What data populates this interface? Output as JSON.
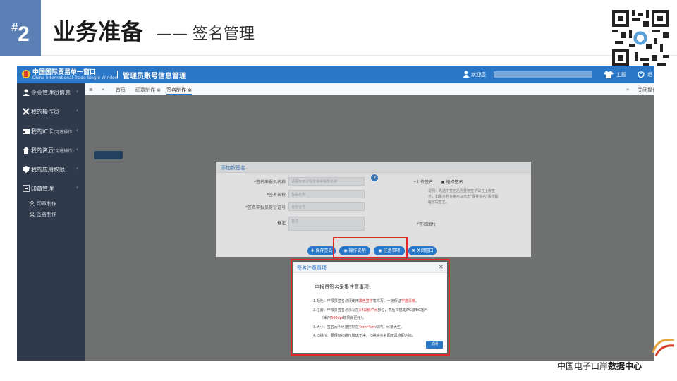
{
  "header": {
    "badge_symbol": "#",
    "badge_num": "2",
    "title": "业务准备",
    "subtitle": "—— 签名管理"
  },
  "topbar": {
    "logo_cn": "中国国际贸易单一窗口",
    "logo_en": "China International Trade Single Window",
    "system_name": "管理员账号信息管理",
    "welcome": "欢迎您",
    "theme": "主题",
    "exit": "退"
  },
  "sidebar": {
    "items": [
      {
        "label": "企业管理员信息",
        "note": "",
        "icon": "user-icon"
      },
      {
        "label": "我的操作员",
        "note": "",
        "icon": "tools-icon"
      },
      {
        "label": "我的IC卡",
        "note": "(可选操作)",
        "icon": "card-icon"
      },
      {
        "label": "我的资质",
        "note": "(可选操作)",
        "icon": "home-icon"
      },
      {
        "label": "我的应用权限",
        "note": "",
        "icon": "shield-icon"
      },
      {
        "label": "印章管理",
        "note": "",
        "icon": "stamp-icon"
      }
    ],
    "subitems": [
      "印章制作",
      "签名制作"
    ]
  },
  "tabs": {
    "home": "首页",
    "seal": "印章制作",
    "sign": "签名制作",
    "close_ops": "关闭操作"
  },
  "sign_dialog": {
    "title": "添加新签名",
    "fields": [
      {
        "label": "*签名申报员名称",
        "placeholder": "请录签名过程发货申报员名称"
      },
      {
        "label": "*签名名称",
        "placeholder": "签名名称"
      },
      {
        "label": "*签名申报员身份证号",
        "placeholder": "身份证号"
      },
      {
        "label": "备注",
        "placeholder": "备注"
      }
    ],
    "upload_label": "*上传签名",
    "select_sign": "选择签名",
    "desc": "说明：先选中签名后完整地签了请在上传签名，如果签名合格可以点击\"保存签名\"系统提醒字段签名。",
    "sign_image_label": "*签名图片"
  },
  "actions": {
    "save": "保存签名",
    "guide": "操作说明",
    "notes": "注意事项",
    "close": "关闭窗口"
  },
  "notes_dialog": {
    "title": "签名注意事项",
    "heading": "申报员签名采集注意事项:",
    "line1_pre": "1.颜色：申报员签名必须使用",
    "line1_red": "黑色签字",
    "line1_mid": "笔书写，一定保证",
    "line1_red2": "字迹清晰",
    "line1_post": "。",
    "line2_pre": "2.位置：申报员签名必须写在",
    "line2_red": "A4白纸中间",
    "line2_post": "部位，然后扫描成JPG/JPEG图片",
    "line2b_pre": "（采用",
    "line2b_red": "600dpi",
    "line2b_post": "效果会更好）。",
    "line3_pre": "3.大小：签名大小尽量控制在",
    "line3_red": "4cm*4cm",
    "line3_post": "以内，尽量大些。",
    "line4": "4.扫描仪：要保证扫描仪玻璃干净，扫描完签名图无黑点即达标。",
    "close_btn": "关闭"
  },
  "footer": {
    "normal": "中国电子口岸",
    "bold": "数据中心"
  },
  "colors": {
    "accent": "#2a77c8",
    "highlight": "#e0282b",
    "badge": "#5a7fb5"
  }
}
